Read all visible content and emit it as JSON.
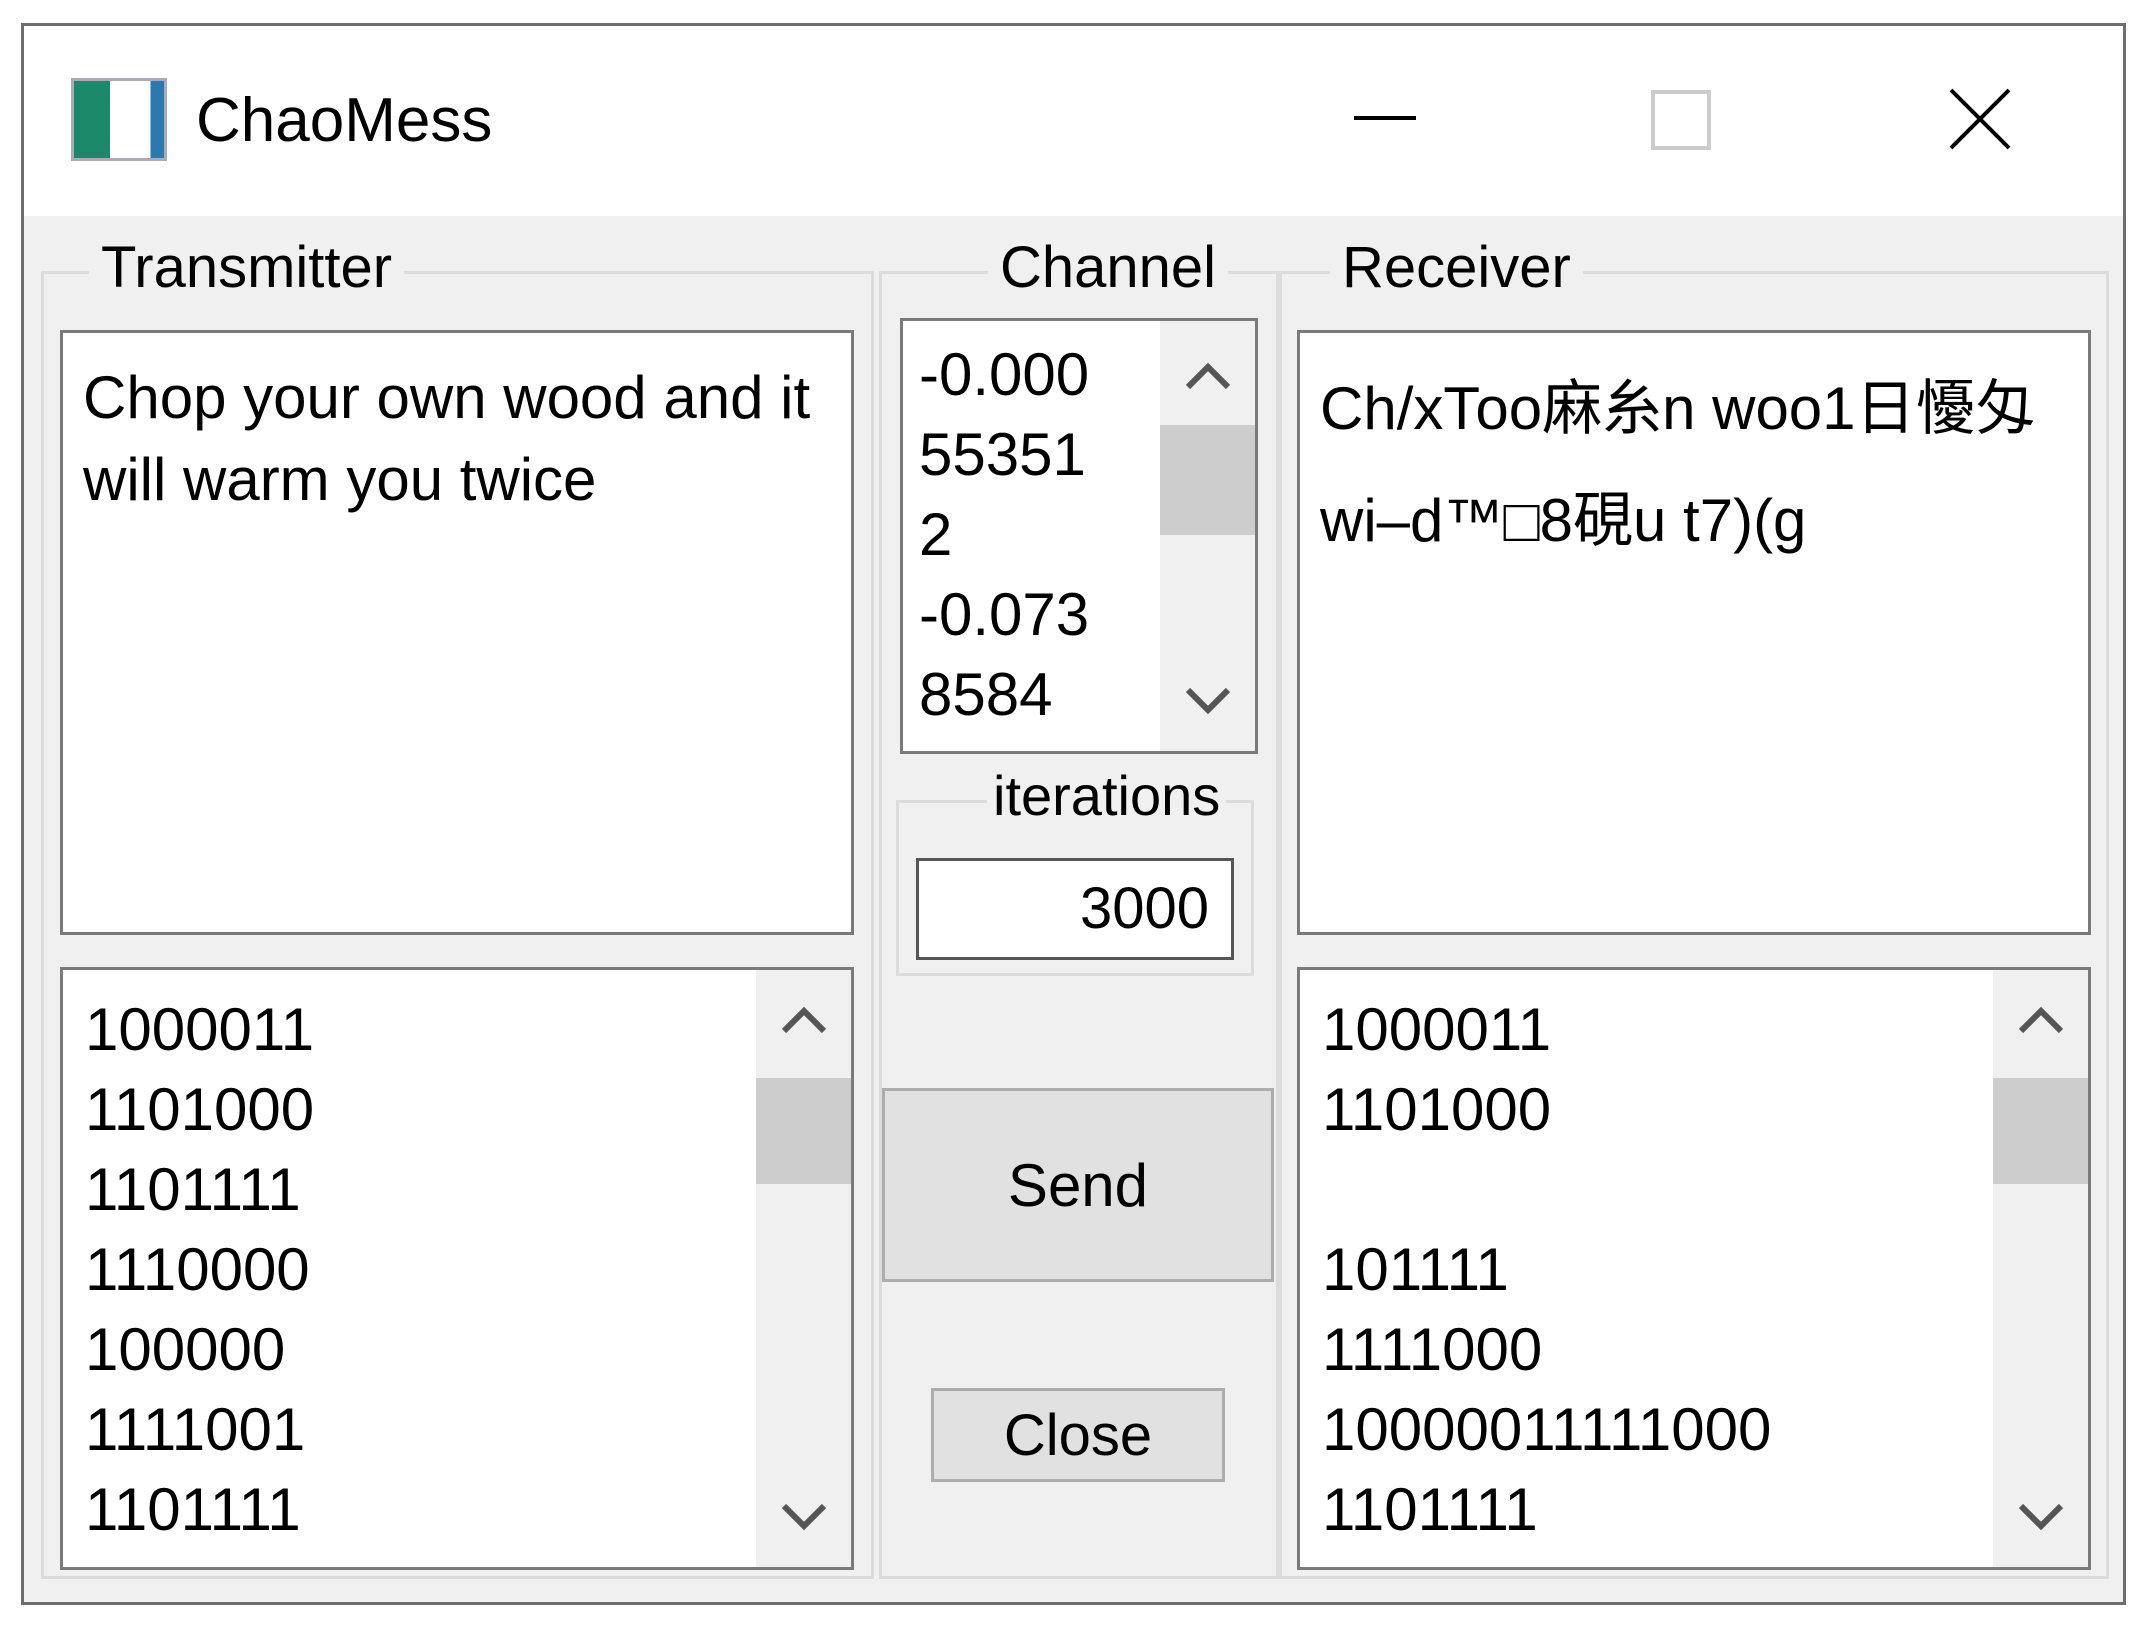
{
  "window": {
    "title": "ChaoMess",
    "minimize_icon": "minimize-icon",
    "maximize_icon": "maximize-icon",
    "close_icon": "close-icon"
  },
  "transmitter": {
    "label": "Transmitter",
    "message": "Chop your own wood and it will warm you twice",
    "bits": [
      "1000011",
      "1101000",
      "1101111",
      "1110000",
      "100000",
      "1111001",
      "1101111"
    ]
  },
  "channel": {
    "label": "Channel",
    "values": [
      "-0.000",
      "55351",
      "2",
      "-0.073",
      "8584"
    ],
    "iterations_label": "iterations",
    "iterations": "3000",
    "send_label": "Send",
    "close_label": "Close"
  },
  "receiver": {
    "label": "Receiver",
    "message_lines": [
      "Ch/xТоo麻糸n woo1日懮匁",
      "wi–d™□8硯u t7)(g"
    ],
    "bits": [
      "1000011",
      "1101000",
      "",
      "101111",
      "1111000",
      "10000011111000",
      "1101111"
    ]
  }
}
